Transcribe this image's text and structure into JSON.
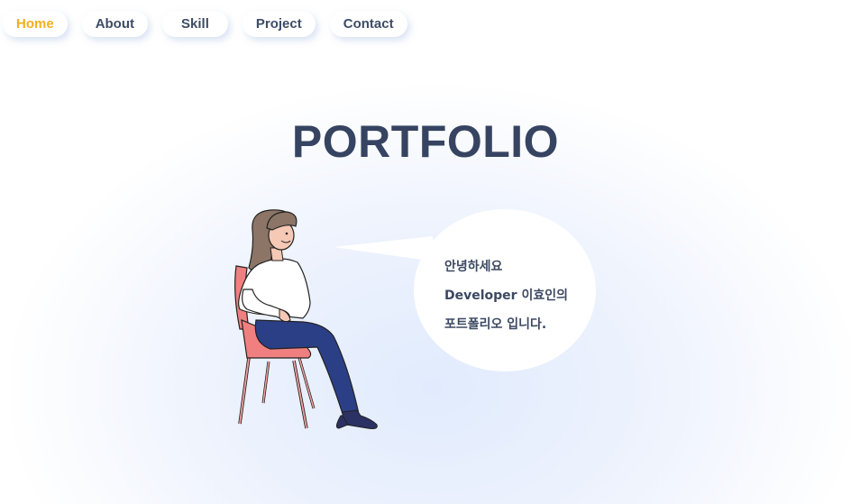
{
  "nav": {
    "items": [
      {
        "label": "Home",
        "active": true
      },
      {
        "label": "About",
        "active": false
      },
      {
        "label": "Skill",
        "active": false
      },
      {
        "label": "Project",
        "active": false
      },
      {
        "label": "Contact",
        "active": false
      }
    ]
  },
  "hero": {
    "title": "PORTFOLIO",
    "greeting": {
      "line1": "안녕하세요",
      "line2": "Developer 이효인의",
      "line3": "포트폴리오 입니다."
    }
  },
  "illustration": "woman-sitting-on-chair",
  "colors": {
    "accent": "#f2b01e",
    "text": "#3d4d66",
    "title": "#364462",
    "chair": "#f08080",
    "pants": "#2b3f86",
    "hair": "#8c7566"
  }
}
